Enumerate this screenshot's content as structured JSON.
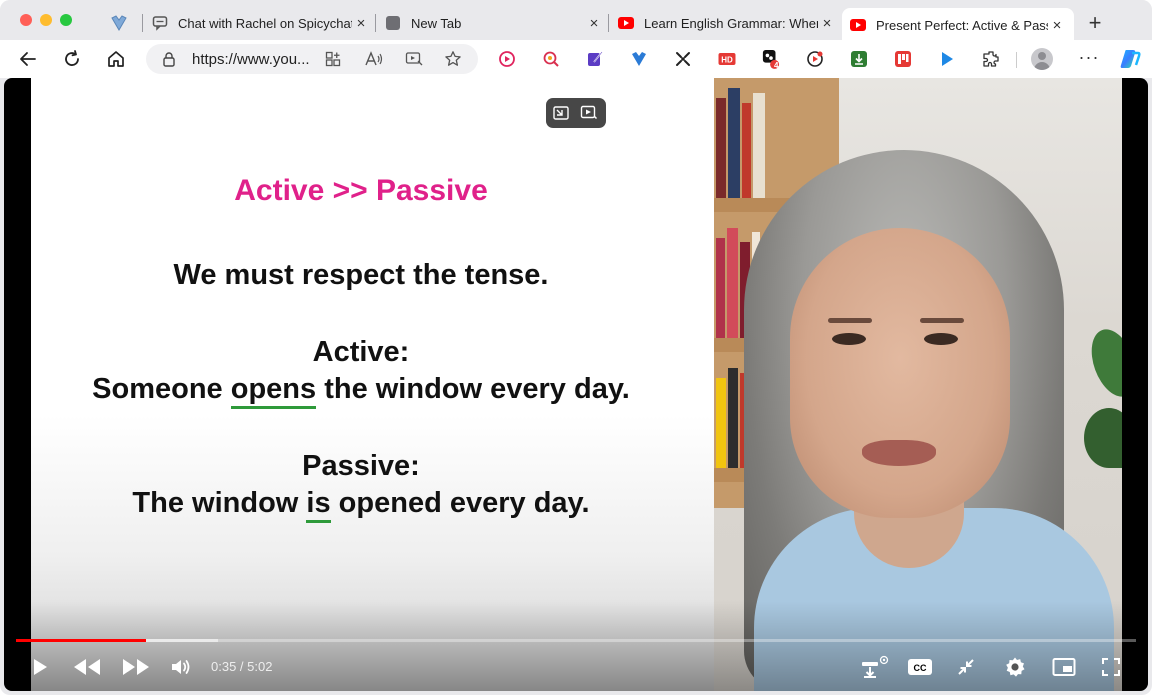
{
  "tabs": [
    {
      "label": "Chat with Rachel on Spicychat",
      "close": "×"
    },
    {
      "label": "New Tab",
      "close": "×"
    },
    {
      "label": "Learn English Grammar: When",
      "close": "×"
    },
    {
      "label": "Present Perfect: Active & Passive",
      "close": "×"
    }
  ],
  "new_tab_label": "+",
  "toolbar": {
    "url": "https://www.you...",
    "more_label": "···",
    "badge_count": "4"
  },
  "slide": {
    "title": "Active >> Passive",
    "line1": "We must respect the tense.",
    "active_label": "Active:",
    "active_pre": "Someone ",
    "active_verb": "opens",
    "active_post": " the window every day.",
    "passive_label": "Passive:",
    "passive_pre": "The window ",
    "passive_verb": "is",
    "passive_post": " opened every day."
  },
  "player": {
    "time": "0:35 / 5:02",
    "progress_fraction": 0.116,
    "buffered_fraction": 0.18
  },
  "colors": {
    "accent_red": "#ff0000",
    "slide_title": "#e0218a",
    "underline": "#2e9a3a"
  },
  "icons": [
    "back-icon",
    "reload-icon",
    "home-icon",
    "lock-icon",
    "split-screen-icon",
    "read-aloud-icon",
    "immersive-reader-icon",
    "favorite-star-icon",
    "extensions-icon",
    "play-icon",
    "rewind-icon",
    "fast-forward-icon",
    "volume-icon",
    "settings-gear-icon",
    "captions-icon",
    "miniplayer-icon",
    "fullscreen-icon",
    "exit-fullscreen-icon",
    "autoplay-icon"
  ]
}
